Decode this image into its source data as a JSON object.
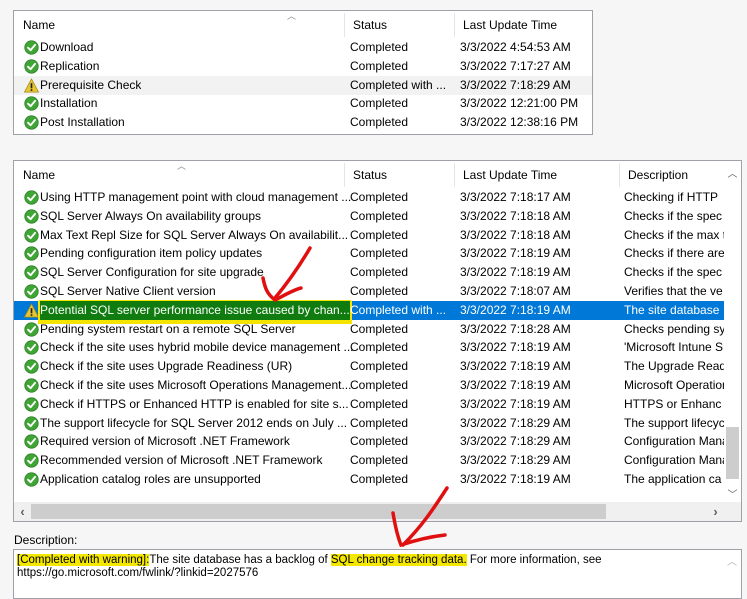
{
  "top_list": {
    "columns": [
      "Name",
      "Status",
      "Last Update Time"
    ],
    "rows": [
      {
        "icon": "check-icon",
        "name": "Download",
        "status": "Completed",
        "time": "3/3/2022 4:54:53 AM"
      },
      {
        "icon": "check-icon",
        "name": "Replication",
        "status": "Completed",
        "time": "3/3/2022 7:17:27 AM"
      },
      {
        "icon": "warning-icon",
        "name": "Prerequisite Check",
        "status": "Completed with ...",
        "time": "3/3/2022 7:18:29 AM"
      },
      {
        "icon": "check-icon",
        "name": "Installation",
        "status": "Completed",
        "time": "3/3/2022 12:21:00 PM"
      },
      {
        "icon": "check-icon",
        "name": "Post Installation",
        "status": "Completed",
        "time": "3/3/2022 12:38:16 PM"
      }
    ]
  },
  "bottom_list": {
    "columns": [
      "Name",
      "Status",
      "Last Update Time",
      "Description"
    ],
    "rows": [
      {
        "icon": "check-icon",
        "name": "Using HTTP management point with cloud management ...",
        "status": "Completed",
        "time": "3/3/2022 7:18:17 AM",
        "desc": "Checking if HTTP"
      },
      {
        "icon": "check-icon",
        "name": "SQL Server Always On availability groups",
        "status": "Completed",
        "time": "3/3/2022 7:18:18 AM",
        "desc": "Checks if the spec"
      },
      {
        "icon": "check-icon",
        "name": "Max Text Repl Size for SQL Server Always On availabilit...",
        "status": "Completed",
        "time": "3/3/2022 7:18:18 AM",
        "desc": "Checks if the max t"
      },
      {
        "icon": "check-icon",
        "name": "Pending configuration item policy updates",
        "status": "Completed",
        "time": "3/3/2022 7:18:19 AM",
        "desc": "Checks if there are"
      },
      {
        "icon": "check-icon",
        "name": "SQL Server Configuration for site upgrade",
        "status": "Completed",
        "time": "3/3/2022 7:18:19 AM",
        "desc": "Checks if the spec"
      },
      {
        "icon": "check-icon",
        "name": "SQL Server Native Client version",
        "status": "Completed",
        "time": "3/3/2022 7:18:07 AM",
        "desc": "Verifies that the ve"
      },
      {
        "icon": "warning-icon",
        "name": "Potential SQL server performance issue caused by chan...",
        "status": "Completed with ...",
        "time": "3/3/2022 7:18:19 AM",
        "desc": "The site database",
        "selected": true
      },
      {
        "icon": "check-icon",
        "name": "Pending system restart on a remote SQL Server",
        "status": "Completed",
        "time": "3/3/2022 7:18:28 AM",
        "desc": "Checks pending sy"
      },
      {
        "icon": "check-icon",
        "name": "Check if the site uses hybrid mobile device management ...",
        "status": "Completed",
        "time": "3/3/2022 7:18:19 AM",
        "desc": "'Microsoft Intune S"
      },
      {
        "icon": "check-icon",
        "name": "Check if the site uses Upgrade Readiness (UR)",
        "status": "Completed",
        "time": "3/3/2022 7:18:19 AM",
        "desc": "The Upgrade Read"
      },
      {
        "icon": "check-icon",
        "name": "Check if the site uses Microsoft Operations Management...",
        "status": "Completed",
        "time": "3/3/2022 7:18:19 AM",
        "desc": "Microsoft Operation"
      },
      {
        "icon": "check-icon",
        "name": "Check if HTTPS or Enhanced HTTP is enabled for site s...",
        "status": "Completed",
        "time": "3/3/2022 7:18:19 AM",
        "desc": "HTTPS or Enhanc"
      },
      {
        "icon": "check-icon",
        "name": "The support lifecycle for SQL Server 2012 ends on July ...",
        "status": "Completed",
        "time": "3/3/2022 7:18:29 AM",
        "desc": "The support lifecyc"
      },
      {
        "icon": "check-icon",
        "name": "Required version of Microsoft .NET Framework",
        "status": "Completed",
        "time": "3/3/2022 7:18:29 AM",
        "desc": "Configuration Mana"
      },
      {
        "icon": "check-icon",
        "name": "Recommended version of Microsoft .NET Framework",
        "status": "Completed",
        "time": "3/3/2022 7:18:29 AM",
        "desc": "Configuration Mana"
      },
      {
        "icon": "check-icon",
        "name": "Application catalog roles are unsupported",
        "status": "Completed",
        "time": "3/3/2022 7:18:19 AM",
        "desc": "The application ca"
      }
    ]
  },
  "description": {
    "label": "Description:",
    "status_tag": "[Completed with warning]:",
    "text_before": "The site database has a backlog of ",
    "highlight": "SQL change tracking data.",
    "text_after": " For more information, see",
    "link": "https://go.microsoft.com/fwlink/?linkid=2027576"
  },
  "colors": {
    "selection": "#0078d7",
    "highlight_yellow": "#f5e800",
    "annotation_red": "#e01010",
    "check_green": "#3fa535",
    "warning_yellow": "#e8c630"
  }
}
